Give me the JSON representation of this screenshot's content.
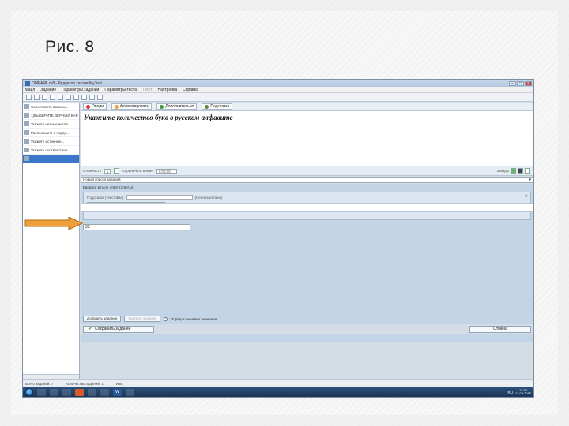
{
  "slide": {
    "title": "Рис. 8"
  },
  "window": {
    "title": "ОМРАЯL.m8 - Редактор тестов MyTest",
    "controls": [
      "–",
      "□",
      "×"
    ]
  },
  "menu": [
    "Файл",
    "Задание",
    "Параметры заданий",
    "Параметры теста",
    "Текст",
    "Настройка",
    "Справка"
  ],
  "tasks": [
    {
      "label": "Сопоставить взаимы...",
      "selected": false
    },
    {
      "label": "1)ВЫБЕРИТЕ ВЕРНЫЙ ВАР",
      "selected": false
    },
    {
      "label": "Укажите четные числа",
      "selected": false
    },
    {
      "label": "Расположите в поряд...",
      "selected": false
    },
    {
      "label": "Укажите истинные...",
      "selected": false
    },
    {
      "label": "Укажите соответствие",
      "selected": false
    },
    {
      "label": "",
      "selected": true
    }
  ],
  "action_bar": {
    "options": "Опции",
    "format": "Форматировать",
    "extra": "Дополнительно",
    "hint": "Подсказка"
  },
  "editor": {
    "question_text": "Укажите количество букв в русском алфавите"
  },
  "settings": {
    "attempts_label": "Сложность",
    "attempts_value": "1",
    "time_label": "Ограничить время",
    "time_value": "0:00:00",
    "right_label": "Звёзды"
  },
  "type_select": {
    "value": "Новый список заданий"
  },
  "answer": {
    "header": "Введите в поле ответ (ответы)",
    "field_label": "Подсказка (текстовая)",
    "field_hint": "(Необязательно)",
    "tab_exact": "Значение равно",
    "tab_range": "Значение в промежутке",
    "value": "33",
    "corner": "✕"
  },
  "bottom": {
    "add_button": "Добавить задание",
    "delete_button": "Удалить задание",
    "checkbox_label": "Порядок не имеет значения"
  },
  "save_row": {
    "save_button": "Сохранить задание",
    "cancel_button": "Отмена"
  },
  "status": {
    "left": "Всего заданий: 7",
    "middle": "Количество заданий: 1",
    "right": "Изм."
  },
  "tray": {
    "lang": "RU",
    "time": "12:37",
    "date": "13.03.2015"
  },
  "colors": {
    "arrow": "#f0a03a",
    "arrow_border": "#b36b12"
  }
}
